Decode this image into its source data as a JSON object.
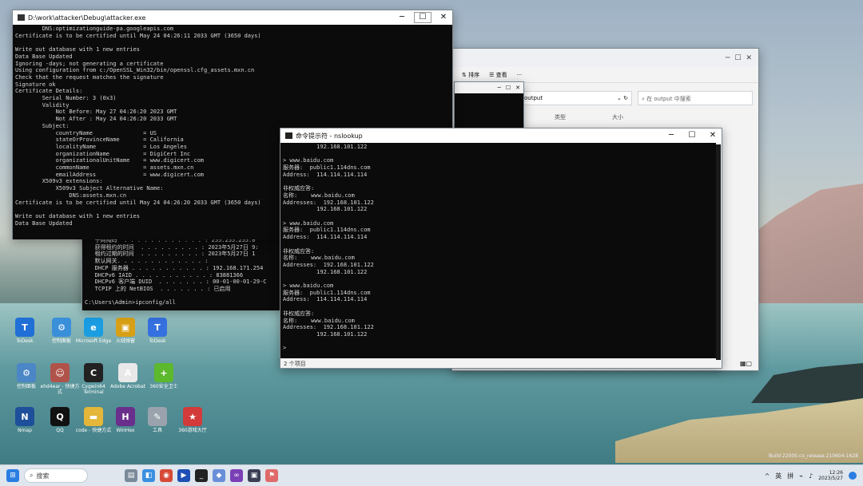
{
  "attacker_window": {
    "title": "D:\\work\\attacker\\Debug\\attacker.exe",
    "lines": [
      "        DNS:optimizationguide-pa.googleapis.com",
      "Certificate is to be certified until May 24 04:26:11 2033 GMT (3650 days)",
      "",
      "Write out database with 1 new entries",
      "Data Base Updated",
      "Ignoring -days; not generating a certificate",
      "Using configuration from c:/OpenSSL_Win32/bin/openssl.cfg_assets.mxn.cn",
      "Check that the request matches the signature",
      "Signature ok",
      "Certificate Details:",
      "        Serial Number: 3 (0x3)",
      "        Validity",
      "            Not Before: May 27 04:26:20 2023 GMT",
      "            Not After : May 24 04:26:20 2033 GMT",
      "        Subject:",
      "            countryName               = US",
      "            stateOrProvinceName       = California",
      "            localityName              = Los Angeles",
      "            organizationName          = DigiCert Inc",
      "            organizationalUnitName    = www.digicert.com",
      "            commonName                = assets.mxn.cn",
      "            emailAddress              = www.digicert.com",
      "        X509v3 extensions:",
      "            X509v3 Subject Alternative Name:",
      "                DNS:assets.mxn.cn",
      "Certificate is to be certified until May 24 04:26:20 2033 GMT (3650 days)",
      "",
      "Write out database with 1 new entries",
      "Data Base Updated"
    ]
  },
  "ipconfig_window": {
    "lines": [
      "   子网掩码  . . . . . . . . . . . . : 255.255.255.0",
      "   获得租约的时间  . . . . . . . . . : 2023年5月27日 9:",
      "   租约过期的时间  . . . . . . . . . : 2023年5月27日 1",
      "   默认网关. . . . . . . . . . . . . :",
      "   DHCP 服务器 . . . . . . . . . . . : 192.168.171.254",
      "   DHCPv6 IAID . . . . . . . . . . . : 83881366",
      "   DHCPv6 客户端 DUID  . . . . . . . : 00-01-00-01-29-C",
      "   TCPIP 上的 NetBIOS  . . . . . . . : 已启用",
      "",
      "C:\\Users\\Admin>ipconfig/all"
    ]
  },
  "explorer_window": {
    "sort_label": "排序",
    "view_label": "查看",
    "address": "output",
    "search_placeholder": "在 output 中搜索",
    "col_type": "类型",
    "col_size": "大小"
  },
  "nslookup_window": {
    "title": "命令提示符 - nslookup",
    "lines": [
      "          192.168.101.122",
      "",
      "> www.baidu.com",
      "服务器:  public1.114dns.com",
      "Address:  114.114.114.114",
      "",
      "非权威应答:",
      "名称:    www.baidu.com",
      "Addresses:  192.168.101.122",
      "          192.168.101.122",
      "",
      "> www.baidu.com",
      "服务器:  public1.114dns.com",
      "Address:  114.114.114.114",
      "",
      "非权威应答:",
      "名称:    www.baidu.com",
      "Addresses:  192.168.101.122",
      "          192.168.101.122",
      "",
      "> www.baidu.com",
      "服务器:  public1.114dns.com",
      "Address:  114.114.114.114",
      "",
      "非权威应答:",
      "名称:    www.baidu.com",
      "Addresses:  192.168.101.122",
      "          192.168.101.122",
      "",
      ">"
    ],
    "status": "2 个项目"
  },
  "desktop_icons": [
    {
      "label": "ToDesk",
      "glyph": "T",
      "color": "#1f6fd6"
    },
    {
      "label": "控制面板",
      "glyph": "⚙",
      "color": "#3a8fd9"
    },
    {
      "label": "Microsoft Edge",
      "glyph": "e",
      "color": "#1b9de2"
    },
    {
      "label": "火绒弹窗",
      "glyph": "▣",
      "color": "#d8a016"
    },
    {
      "label": "ToDesk",
      "glyph": "T",
      "color": "#3570e0"
    },
    {
      "label": "控制面板",
      "glyph": "⚙",
      "color": "#4b86c6"
    },
    {
      "label": "ehd4ear - 快捷方式",
      "glyph": "☺",
      "color": "#b0534a"
    },
    {
      "label": "Cygwin64 Terminal",
      "glyph": "C",
      "color": "#222222"
    },
    {
      "label": "Adobe Acrobat",
      "glyph": "A",
      "color": "#e8e8e8"
    },
    {
      "label": "360安全卫士",
      "glyph": "+",
      "color": "#5cb82c"
    },
    {
      "label": "Nmap",
      "glyph": "N",
      "color": "#1e4f9a"
    },
    {
      "label": "QQ",
      "glyph": "Q",
      "color": "#111111"
    },
    {
      "label": "code - 快捷方式",
      "glyph": "▬",
      "color": "#e4b63a"
    },
    {
      "label": "WinHex",
      "glyph": "H",
      "color": "#6a2f8c"
    },
    {
      "label": "工具",
      "glyph": "✎",
      "color": "#9aa3ad"
    },
    {
      "label": "360游戏大厅",
      "glyph": "★",
      "color": "#d33a3a"
    }
  ],
  "taskbar": {
    "search_label": "搜索",
    "lang": "英",
    "ime": "拼",
    "time": "12:26",
    "date": "2023/5/27",
    "build_text": "Build 22000.co_release.210604-1628"
  }
}
